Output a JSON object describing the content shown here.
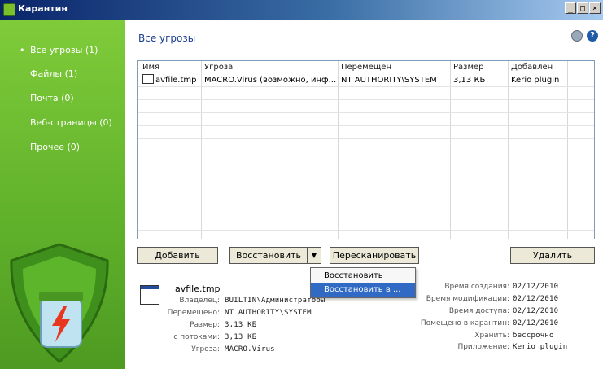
{
  "window": {
    "title": "Карантин",
    "min_label": "_",
    "max_label": "□",
    "close_label": "×"
  },
  "sidebar": {
    "items": [
      {
        "label": "Все угрозы (1)",
        "active": true
      },
      {
        "label": "Файлы (1)"
      },
      {
        "label": "Почта (0)"
      },
      {
        "label": "Веб-страницы (0)"
      },
      {
        "label": "Прочее (0)"
      }
    ]
  },
  "main": {
    "title": "Все угрозы",
    "help_label": "?"
  },
  "table": {
    "headers": [
      "Имя",
      "Угроза",
      "Перемещен",
      "Размер",
      "Добавлен"
    ],
    "rows": [
      [
        "avfile.tmp",
        "MACRO.Virus (возможно, инф...",
        "NT AUTHORITY\\SYSTEM",
        "3,13 КБ",
        "Kerio plugin"
      ]
    ]
  },
  "buttons": {
    "add": "Добавить",
    "restore": "Восстановить",
    "rescan": "Пересканировать",
    "delete": "Удалить"
  },
  "restore_menu": {
    "items": [
      "Восстановить",
      "Восстановить в ..."
    ]
  },
  "details": {
    "file_name": "avfile.tmp",
    "left": [
      {
        "label": "Владелец:",
        "value": "BUILTIN\\Администраторы"
      },
      {
        "label": "Перемещено:",
        "value": "NT AUTHORITY\\SYSTEM"
      },
      {
        "label": "Размер:",
        "value": "3,13 КБ"
      },
      {
        "label": "с потоками:",
        "value": "3,13 КБ"
      },
      {
        "label": "Угроза:",
        "value": "MACRO.Virus"
      }
    ],
    "right": [
      {
        "label": "Время создания:",
        "value": "02/12/2010"
      },
      {
        "label": "Время модификации:",
        "value": "02/12/2010"
      },
      {
        "label": "Время доступа:",
        "value": "02/12/2010"
      },
      {
        "label": "Помещено в карантин:",
        "value": "02/12/2010"
      },
      {
        "label": "Хранить:",
        "value": "бессрочно"
      },
      {
        "label": "Приложение:",
        "value": "Kerio plugin"
      }
    ]
  },
  "colors": {
    "sidebar": "#6cbd2f",
    "title_blue": "#1b3f8f",
    "highlight": "#316ac5"
  }
}
